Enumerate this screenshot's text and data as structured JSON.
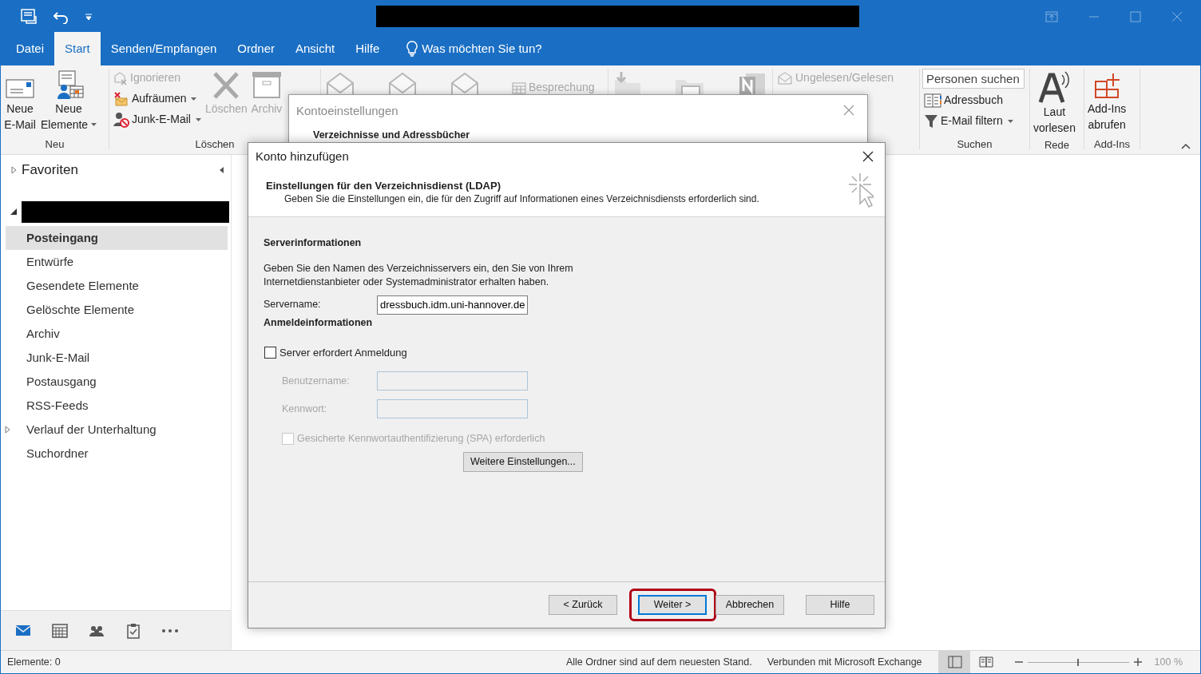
{
  "tabs": [
    {
      "label": "Datei",
      "selected": false
    },
    {
      "label": "Start",
      "selected": true
    },
    {
      "label": "Senden/Empfangen",
      "selected": false
    },
    {
      "label": "Ordner",
      "selected": false
    },
    {
      "label": "Ansicht",
      "selected": false
    },
    {
      "label": "Hilfe",
      "selected": false
    }
  ],
  "tell_me": "Was möchten Sie tun?",
  "ribbon": {
    "groups": [
      {
        "label": "Neu",
        "columns": [
          [
            {
              "kind": "large",
              "lines": [
                "Neue",
                "E-Mail"
              ],
              "dropdown": false,
              "disabled": false
            }
          ],
          [
            {
              "kind": "large",
              "lines": [
                "Neue",
                "Elemente"
              ],
              "dropdown": true,
              "disabled": false
            }
          ]
        ]
      },
      {
        "label": "Löschen",
        "columns": [
          [
            {
              "kind": "small",
              "lines": [
                "Ignorieren"
              ],
              "dropdown": false,
              "disabled": true
            },
            {
              "kind": "small",
              "lines": [
                "Aufräumen"
              ],
              "dropdown": true,
              "disabled": false
            },
            {
              "kind": "small",
              "lines": [
                "Junk-E-Mail"
              ],
              "dropdown": true,
              "disabled": false
            }
          ],
          [
            {
              "kind": "large",
              "lines": [
                "Löschen"
              ],
              "dropdown": false,
              "disabled": true
            }
          ],
          [
            {
              "kind": "large",
              "lines": [
                "Archiv"
              ],
              "dropdown": false,
              "disabled": true
            }
          ]
        ]
      },
      {
        "columns": [
          [
            {
              "kind": "icon",
              "disabled": true
            }
          ],
          [
            {
              "kind": "icon",
              "disabled": true
            }
          ],
          [
            {
              "kind": "icon",
              "disabled": true
            }
          ],
          [
            {
              "kind": "small",
              "lines": [
                "Besprechung"
              ],
              "dropdown": false,
              "disabled": true
            }
          ]
        ]
      },
      {
        "columns": [
          [
            {
              "kind": "icon",
              "disabled": true
            }
          ],
          [
            {
              "kind": "icon",
              "disabled": true
            }
          ],
          [
            {
              "kind": "icon",
              "disabled": true
            }
          ]
        ]
      },
      {
        "columns": [
          [
            {
              "kind": "small",
              "lines": [
                "Ungelesen/Gelesen"
              ],
              "dropdown": false,
              "disabled": true
            }
          ]
        ]
      },
      {
        "label": "Suchen",
        "columns": [
          [
            {
              "kind": "search",
              "placeholder": "Personen suchen"
            },
            {
              "kind": "small",
              "lines": [
                "Adressbuch"
              ],
              "dropdown": false,
              "disabled": false
            },
            {
              "kind": "small",
              "lines": [
                "E-Mail filtern"
              ],
              "dropdown": true,
              "disabled": false
            }
          ]
        ]
      },
      {
        "label": "Rede",
        "columns": [
          [
            {
              "kind": "large",
              "lines": [
                "Laut",
                "vorlesen"
              ],
              "dropdown": false,
              "disabled": false
            }
          ]
        ]
      },
      {
        "label": "Add-Ins",
        "columns": [
          [
            {
              "kind": "large",
              "lines": [
                "Add-Ins",
                "abrufen"
              ],
              "dropdown": false,
              "disabled": false
            }
          ]
        ]
      }
    ]
  },
  "sidebar": {
    "favorites": {
      "label": "Favoriten",
      "expanded": false
    },
    "folders": [
      {
        "label": "Posteingang",
        "selected": true,
        "has_children": false
      },
      {
        "label": "Entwürfe",
        "selected": false,
        "has_children": false
      },
      {
        "label": "Gesendete Elemente",
        "selected": false,
        "has_children": false
      },
      {
        "label": "Gelöschte Elemente",
        "selected": false,
        "has_children": false
      },
      {
        "label": "Archiv",
        "selected": false,
        "has_children": false
      },
      {
        "label": "Junk-E-Mail",
        "selected": false,
        "has_children": false
      },
      {
        "label": "Postausgang",
        "selected": false,
        "has_children": false
      },
      {
        "label": "RSS-Feeds",
        "selected": false,
        "has_children": false
      },
      {
        "label": "Verlauf der Unterhaltung",
        "selected": false,
        "has_children": true
      },
      {
        "label": "Suchordner",
        "selected": false,
        "has_children": false
      }
    ]
  },
  "nav_bar": [
    {
      "selected": true
    },
    {
      "selected": false
    },
    {
      "selected": false
    },
    {
      "selected": false
    },
    {
      "selected": false
    }
  ],
  "back_dialog": {
    "title": "Kontoeinstellungen",
    "heading": "Verzeichnisse und Adressbücher"
  },
  "dialog": {
    "title": "Konto hinzufügen",
    "heading": "Einstellungen für den Verzeichnisdienst (LDAP)",
    "subheading": "Geben Sie die Einstellungen ein, die für den Zugriff auf Informationen eines Verzeichnisdiensts erforderlich sind.",
    "server_section": {
      "title": "Serverinformationen",
      "text": "Geben Sie den Namen des Verzeichnisservers ein, den Sie von Ihrem\nInternetdienstanbieter oder Systemadministrator erhalten haben.",
      "fields": [
        {
          "label": "Servername:",
          "value": "dressbuch.idm.uni-hannover.de",
          "disabled": false
        }
      ]
    },
    "login_section": {
      "title": "Anmeldeinformationen",
      "requires_login": {
        "label": "Server erfordert Anmeldung",
        "checked": false,
        "disabled": false
      },
      "fields": [
        {
          "label": "Benutzername:",
          "disabled": true
        },
        {
          "label": "Kennwort:",
          "disabled": true
        }
      ],
      "spa": {
        "label": "Gesicherte Kennwortauthentifizierung (SPA) erforderlich",
        "checked": false,
        "disabled": true
      },
      "more_button": "Weitere Einstellungen..."
    },
    "buttons": [
      {
        "label": "< Zurück",
        "default": false,
        "highlighted": false
      },
      {
        "label": "Weiter >",
        "default": true,
        "highlighted": true
      },
      {
        "label": "Abbrechen",
        "default": false,
        "highlighted": false
      },
      {
        "label": "Hilfe",
        "default": false,
        "highlighted": false
      }
    ]
  },
  "status_bar": {
    "items": "Elemente: 0",
    "sync": "Alle Ordner sind auf dem neuesten Stand.",
    "connection": "Verbunden mit Microsoft Exchange",
    "views": [
      {
        "selected": true
      },
      {
        "selected": false
      }
    ],
    "zoom_slider": {
      "level": 0.5
    },
    "zoom": "100 %"
  }
}
